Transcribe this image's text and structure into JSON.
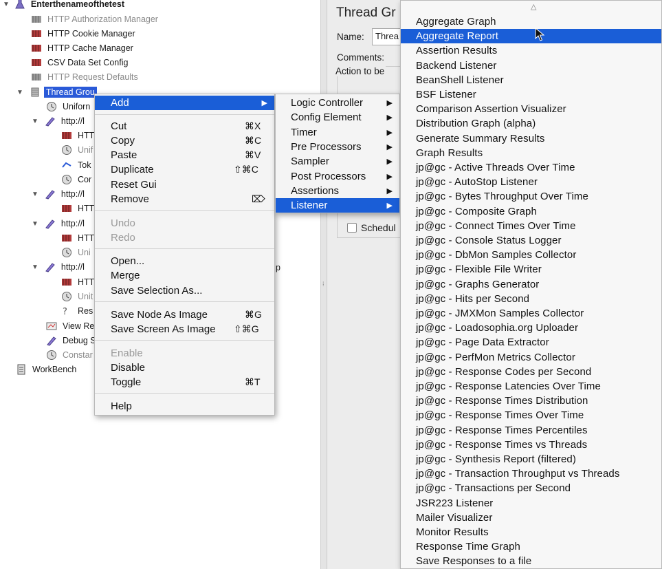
{
  "tree": {
    "root": "Enterthenameofthetest",
    "items": [
      {
        "label": "HTTP Authorization Manager",
        "dim": true
      },
      {
        "label": "HTTP Cookie Manager",
        "dim": false
      },
      {
        "label": "HTTP Cache Manager",
        "dim": false
      },
      {
        "label": "CSV Data Set Config",
        "dim": false
      },
      {
        "label": "HTTP Request Defaults",
        "dim": true
      }
    ],
    "thread_group": "Thread Grou",
    "children": [
      {
        "label": "Uniforn",
        "dim": false
      },
      {
        "label": "http://l",
        "dim": false
      },
      {
        "label": "HTT",
        "dim": false
      },
      {
        "label": "Unif",
        "dim": true
      },
      {
        "label": "Tok",
        "dim": false
      },
      {
        "label": "Cor",
        "dim": false
      },
      {
        "label": "http://l",
        "dim": false
      },
      {
        "label": "HTT",
        "dim": false
      },
      {
        "label": "http://l",
        "dim": false
      },
      {
        "label": "HTT",
        "dim": false
      },
      {
        "label": "Uni",
        "dim": true
      },
      {
        "label": "http://l",
        "dim": false
      },
      {
        "label": "HTT",
        "dim": false
      },
      {
        "label": "Unit",
        "dim": true
      },
      {
        "label": "Res",
        "dim": false
      },
      {
        "label": "View Re",
        "dim": false
      },
      {
        "label": "Debug S",
        "dim": false
      },
      {
        "label": "Constar",
        "dim": true
      }
    ],
    "tail_text": "p",
    "workbench": "WorkBench"
  },
  "panel": {
    "title": "Thread Gr",
    "name_label": "Name:",
    "name_value": "Threa",
    "comments_label": "Comments:",
    "action_label": "Action to be",
    "scheduler_label": "Schedul"
  },
  "context_menu": {
    "add": "Add",
    "cut": "Cut",
    "cut_sc": "⌘X",
    "copy": "Copy",
    "copy_sc": "⌘C",
    "paste": "Paste",
    "paste_sc": "⌘V",
    "duplicate": "Duplicate",
    "duplicate_sc": "⇧⌘C",
    "reset_gui": "Reset Gui",
    "remove": "Remove",
    "remove_sc": "⌦",
    "undo": "Undo",
    "redo": "Redo",
    "open": "Open...",
    "merge": "Merge",
    "save_selection": "Save Selection As...",
    "save_node_image": "Save Node As Image",
    "save_node_image_sc": "⌘G",
    "save_screen_image": "Save Screen As Image",
    "save_screen_image_sc": "⇧⌘G",
    "enable": "Enable",
    "disable": "Disable",
    "toggle": "Toggle",
    "toggle_sc": "⌘T",
    "help": "Help"
  },
  "add_submenu": {
    "items": [
      "Logic Controller",
      "Config Element",
      "Timer",
      "Pre Processors",
      "Sampler",
      "Post Processors",
      "Assertions",
      "Listener"
    ],
    "highlighted_index": 7
  },
  "listener_submenu": {
    "items": [
      "Aggregate Graph",
      "Aggregate Report",
      "Assertion Results",
      "Backend Listener",
      "BeanShell Listener",
      "BSF Listener",
      "Comparison Assertion Visualizer",
      "Distribution Graph (alpha)",
      "Generate Summary Results",
      "Graph Results",
      "jp@gc - Active Threads Over Time",
      "jp@gc - AutoStop Listener",
      "jp@gc - Bytes Throughput Over Time",
      "jp@gc - Composite Graph",
      "jp@gc - Connect Times Over Time",
      "jp@gc - Console Status Logger",
      "jp@gc - DbMon Samples Collector",
      "jp@gc - Flexible File Writer",
      "jp@gc - Graphs Generator",
      "jp@gc - Hits per Second",
      "jp@gc - JMXMon Samples Collector",
      "jp@gc - Loadosophia.org Uploader",
      "jp@gc - Page Data Extractor",
      "jp@gc - PerfMon Metrics Collector",
      "jp@gc - Response Codes per Second",
      "jp@gc - Response Latencies Over Time",
      "jp@gc - Response Times Distribution",
      "jp@gc - Response Times Over Time",
      "jp@gc - Response Times Percentiles",
      "jp@gc - Response Times vs Threads",
      "jp@gc - Synthesis Report (filtered)",
      "jp@gc - Transaction Throughput vs Threads",
      "jp@gc - Transactions per Second",
      "JSR223 Listener",
      "Mailer Visualizer",
      "Monitor Results",
      "Response Time Graph",
      "Save Responses to a file"
    ],
    "highlighted_index": 1
  },
  "colors": {
    "highlight": "#1a5ed7",
    "selection": "#2a5ad8"
  }
}
